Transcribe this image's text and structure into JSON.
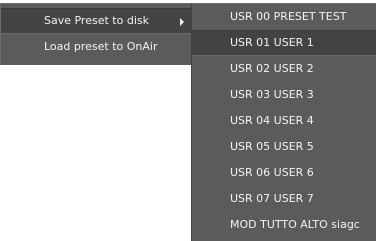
{
  "context_menu": {
    "items": [
      {
        "label": "Save Preset to disk",
        "has_submenu": true,
        "highlighted": true,
        "submenu_arrow_icon": "chevron-right-icon"
      },
      {
        "label": "Load preset to OnAir",
        "has_submenu": false,
        "highlighted": false
      }
    ]
  },
  "submenu": {
    "items": [
      {
        "label": "USR 00 PRESET TEST",
        "highlighted": false
      },
      {
        "label": "USR 01 USER 1",
        "highlighted": true
      },
      {
        "label": "USR 02 USER 2",
        "highlighted": false
      },
      {
        "label": "USR 03 USER 3",
        "highlighted": false
      },
      {
        "label": "USR 04 USER 4",
        "highlighted": false
      },
      {
        "label": "USR 05 USER 5",
        "highlighted": false
      },
      {
        "label": "USR 06 USER 6",
        "highlighted": false
      },
      {
        "label": "USR 07 USER 7",
        "highlighted": false
      },
      {
        "label": "MOD TUTTO ALTO siagc",
        "highlighted": false
      }
    ]
  },
  "colors": {
    "menu_background": "#5b5b5b",
    "highlight_background": "#444444",
    "text": "#f2f2f2"
  }
}
